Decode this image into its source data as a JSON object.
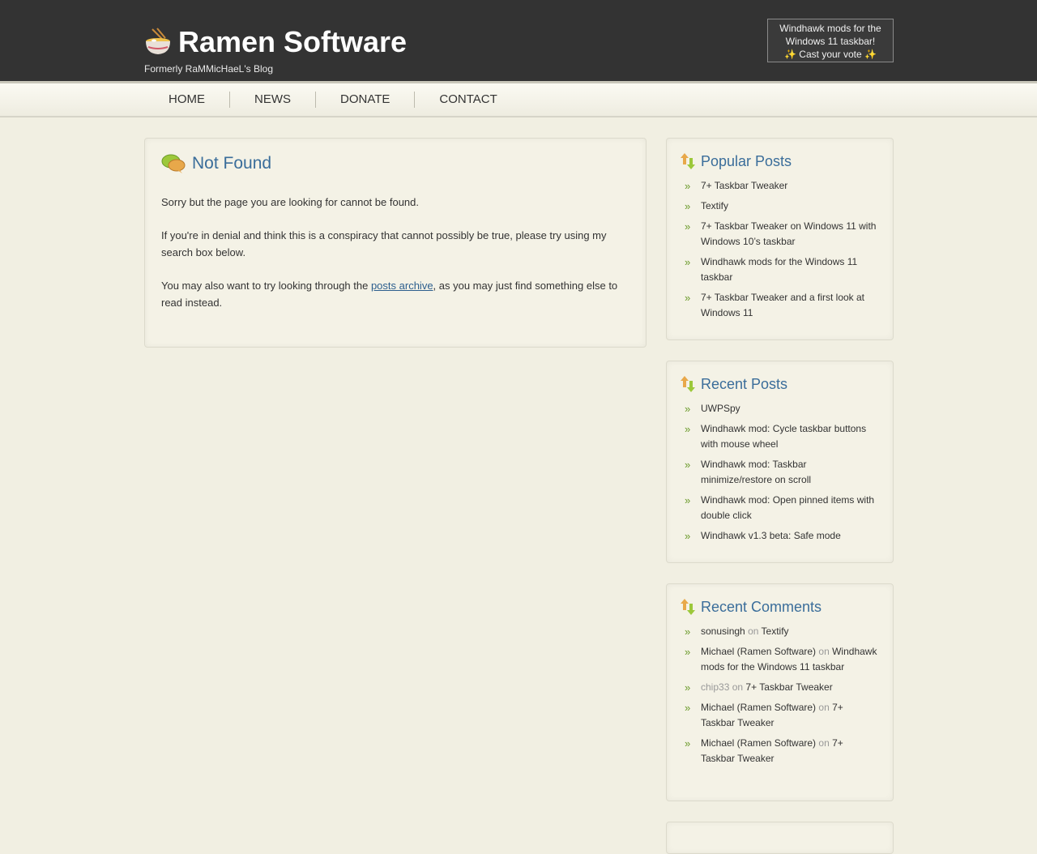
{
  "header": {
    "site_title": "Ramen Software",
    "tagline": "Formerly RaMMicHaeL's Blog",
    "vote_line1": "Windhawk mods for the",
    "vote_line2": "Windows 11 taskbar!",
    "vote_line3": "✨ Cast your vote ✨"
  },
  "nav": {
    "items": [
      "HOME",
      "NEWS",
      "DONATE",
      "CONTACT"
    ]
  },
  "main": {
    "title": "Not Found",
    "para1": "Sorry but the page you are looking for cannot be found.",
    "para2": "If you're in denial and think this is a conspiracy that cannot possibly be true, please try using my search box below.",
    "para3_before": "You may also want to try looking through the ",
    "para3_link": "posts archive",
    "para3_after": ", as you may just find something else to read instead."
  },
  "popular": {
    "title": "Popular Posts",
    "items": [
      "7+ Taskbar Tweaker",
      "Textify",
      "7+ Taskbar Tweaker on Windows 11 with Windows 10’s taskbar",
      "Windhawk mods for the Windows 11 taskbar",
      "7+ Taskbar Tweaker and a first look at Windows 11"
    ]
  },
  "recent_posts": {
    "title": "Recent Posts",
    "items": [
      "UWPSpy",
      "Windhawk mod: Cycle taskbar buttons with mouse wheel",
      "Windhawk mod: Taskbar minimize/restore on scroll",
      "Windhawk mod: Open pinned items with double click",
      "Windhawk v1.3 beta: Safe mode"
    ]
  },
  "recent_comments": {
    "title": "Recent Comments",
    "on_word": "on",
    "items": [
      {
        "author": "sonusingh",
        "post": "Textify"
      },
      {
        "author": "Michael (Ramen Software)",
        "post": "Windhawk mods for the Windows 11 taskbar"
      },
      {
        "author": "chip33",
        "post": "7+ Taskbar Tweaker"
      },
      {
        "author": "Michael (Ramen Software)",
        "post": "7+ Taskbar Tweaker"
      },
      {
        "author": "Michael (Ramen Software)",
        "post": "7+ Taskbar Tweaker"
      }
    ]
  },
  "colors": {
    "header_bg": "#333333",
    "link_blue": "#3a6d9a",
    "bullet_green": "#6a9a2a",
    "page_bg": "#f1efe2"
  },
  "icons": [
    "ramen-bowl-icon",
    "speech-bubbles-icon",
    "up-down-arrows-icon"
  ]
}
